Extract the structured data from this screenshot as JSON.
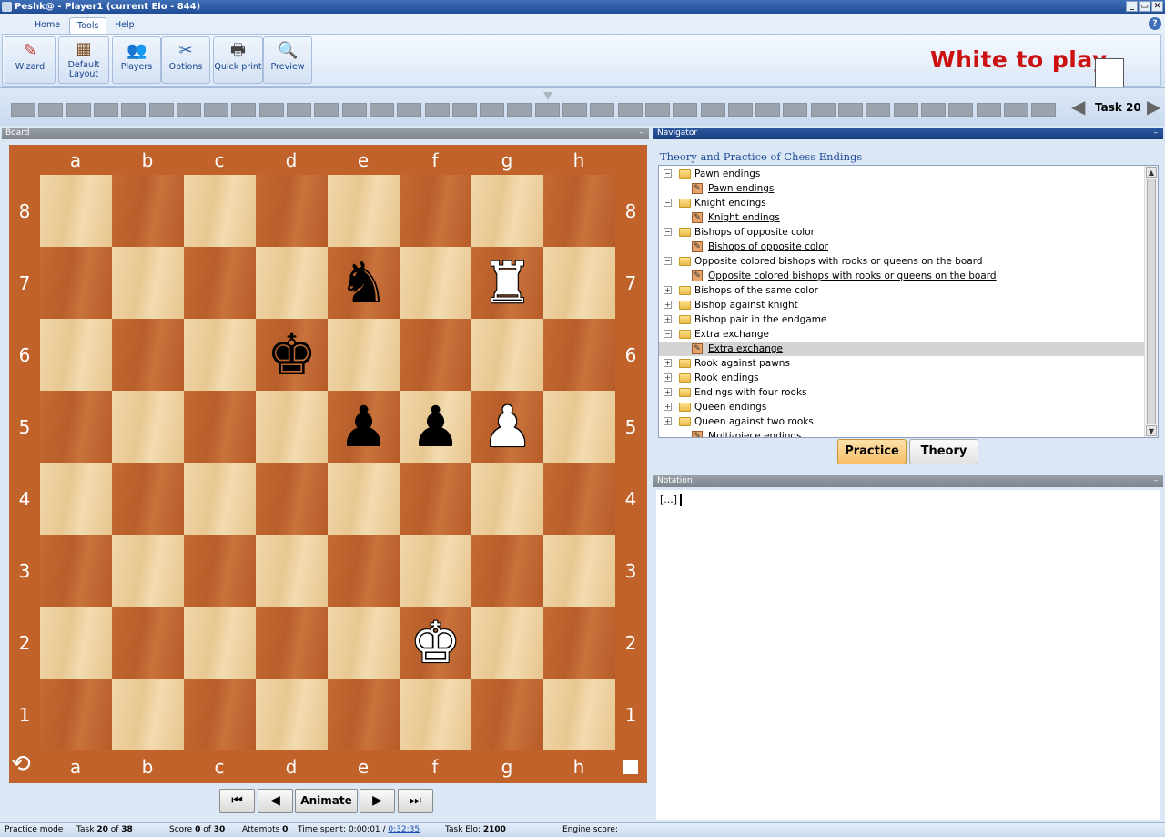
{
  "window": {
    "title": "Peshk@ - Player1 (current Elo - 844)",
    "controls": [
      "_",
      "▭",
      "✕"
    ],
    "help_glyph": "?"
  },
  "ribbon": {
    "tabs": [
      "Home",
      "Tools",
      "Help"
    ],
    "active_tab": "Tools",
    "buttons": [
      {
        "label": "Wizard",
        "icon": "wand-icon",
        "glyph": "✎"
      },
      {
        "label": "Default Layout",
        "label1": "Default",
        "label2": "Layout",
        "icon": "layout-icon",
        "glyph": "▦"
      },
      {
        "label": "Players",
        "icon": "players-icon",
        "glyph": "👥"
      },
      {
        "label": "Options",
        "icon": "options-icon",
        "glyph": "✂"
      },
      {
        "label": "Quick print",
        "icon": "printer-icon",
        "glyph": "🖶"
      },
      {
        "label": "Preview",
        "icon": "preview-icon",
        "glyph": "🔍"
      }
    ],
    "turn_text": "White to play",
    "turn_color": "#cc1111"
  },
  "progress": {
    "total_cells": 38,
    "current_task": 20,
    "task_label": "Task 20",
    "prev_glyph": "◀",
    "next_glyph": "▶"
  },
  "board_panel": {
    "title": "Board",
    "minimize": "–",
    "files": [
      "a",
      "b",
      "c",
      "d",
      "e",
      "f",
      "g",
      "h"
    ],
    "ranks": [
      "8",
      "7",
      "6",
      "5",
      "4",
      "3",
      "2",
      "1"
    ],
    "flip_glyph": "⟲",
    "pieces": [
      {
        "square": "e7",
        "glyph": "♞",
        "side": "black",
        "name": "black-knight"
      },
      {
        "square": "g7",
        "glyph": "♜",
        "side": "white",
        "name": "white-rook"
      },
      {
        "square": "d6",
        "glyph": "♚",
        "side": "black",
        "name": "black-king"
      },
      {
        "square": "e5",
        "glyph": "♟",
        "side": "black",
        "name": "black-pawn"
      },
      {
        "square": "f5",
        "glyph": "♟",
        "side": "black",
        "name": "black-pawn"
      },
      {
        "square": "g5",
        "glyph": "♟",
        "side": "white",
        "name": "white-pawn"
      },
      {
        "square": "f2",
        "glyph": "♚",
        "side": "white",
        "name": "white-king"
      }
    ],
    "nav_buttons": {
      "first": "⏮",
      "prev": "◀",
      "animate": "Animate",
      "next": "▶",
      "last": "⏭"
    }
  },
  "navigator": {
    "title": "Navigator",
    "minimize": "–",
    "book_title": "Theory and Practice of Chess Endings",
    "tree": [
      {
        "label": "Pawn endings",
        "type": "folder",
        "expanded": true
      },
      {
        "label": "Pawn endings",
        "type": "doc"
      },
      {
        "label": "Knight endings",
        "type": "folder",
        "expanded": true
      },
      {
        "label": "Knight endings",
        "type": "doc"
      },
      {
        "label": "Bishops of opposite color",
        "type": "folder",
        "expanded": true
      },
      {
        "label": "Bishops of opposite color",
        "type": "doc"
      },
      {
        "label": "Opposite colored bishops with rooks or queens on the board",
        "type": "folder",
        "expanded": true
      },
      {
        "label": "Opposite colored bishops with rooks or queens on the board",
        "type": "doc"
      },
      {
        "label": "Bishops of the same color",
        "type": "folder",
        "expanded": false
      },
      {
        "label": "Bishop against knight",
        "type": "folder",
        "expanded": false
      },
      {
        "label": "Bishop pair in the endgame",
        "type": "folder",
        "expanded": false
      },
      {
        "label": "Extra exchange",
        "type": "folder",
        "expanded": true
      },
      {
        "label": "Extra exchange",
        "type": "doc",
        "selected": true
      },
      {
        "label": "Rook against pawns",
        "type": "folder",
        "expanded": false
      },
      {
        "label": "Rook endings",
        "type": "folder",
        "expanded": false
      },
      {
        "label": "Endings with four rooks",
        "type": "folder",
        "expanded": false
      },
      {
        "label": "Queen endings",
        "type": "folder",
        "expanded": false
      },
      {
        "label": "Queen against two rooks",
        "type": "folder",
        "expanded": false
      },
      {
        "label": "Multi-piece endings",
        "type": "doc"
      }
    ],
    "practice_label": "Practice",
    "theory_label": "Theory"
  },
  "notation": {
    "title": "Notation",
    "minimize": "–",
    "text": "[...]"
  },
  "status": {
    "mode": "Practice mode",
    "task_prefix": "Task",
    "task_current": "20",
    "task_of": "of",
    "task_total": "38",
    "score_prefix": "Score",
    "score_current": "0",
    "score_of": "of",
    "score_total": "30",
    "attempts_prefix": "Attempts",
    "attempts": "0",
    "time_prefix": "Time spent: 0:00:01 /",
    "time_limit": "0:32:35",
    "elo_prefix": "Task Elo:",
    "elo": "2100",
    "engine_label": "Engine score:"
  }
}
